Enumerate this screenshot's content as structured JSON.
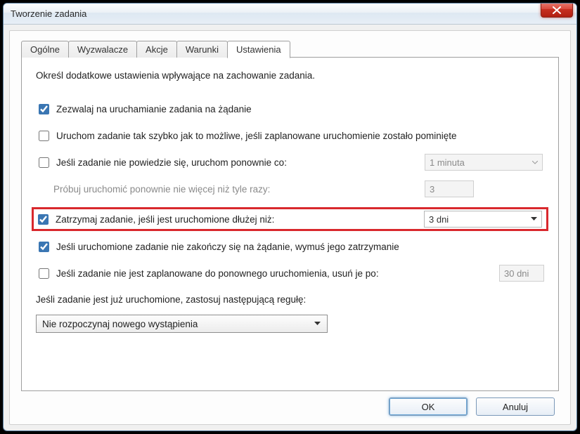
{
  "window": {
    "title": "Tworzenie zadania"
  },
  "tabs": {
    "general": "Ogólne",
    "triggers": "Wyzwalacze",
    "actions": "Akcje",
    "conditions": "Warunki",
    "settings": "Ustawienia"
  },
  "panel": {
    "intro": "Określ dodatkowe ustawienia wpływające na zachowanie zadania.",
    "allow_on_demand": "Zezwalaj na uruchamianie zadania na żądanie",
    "run_asap": "Uruchom zadanie tak szybko jak to możliwe, jeśli zaplanowane uruchomienie zostało pominięte",
    "restart_if_fail": "Jeśli zadanie nie powiedzie się, uruchom ponownie co:",
    "restart_interval": "1  minuta",
    "retry_count_label": "Próbuj uruchomić ponownie nie więcej niż tyle razy:",
    "retry_count_value": "3",
    "stop_if_longer": "Zatrzymaj zadanie, jeśli jest uruchomione dłużej niż:",
    "stop_if_longer_value": "3  dni",
    "force_stop": "Jeśli uruchomione zadanie nie zakończy się na żądanie, wymuś jego zatrzymanie",
    "delete_if_not_scheduled": "Jeśli zadanie nie jest zaplanowane do ponownego uruchomienia, usuń je po:",
    "delete_after_value": "30  dni",
    "rule_label": "Jeśli zadanie jest już uruchomione, zastosuj następującą regułę:",
    "rule_value": "Nie rozpoczynaj nowego wystąpienia"
  },
  "buttons": {
    "ok": "OK",
    "cancel": "Anuluj"
  }
}
